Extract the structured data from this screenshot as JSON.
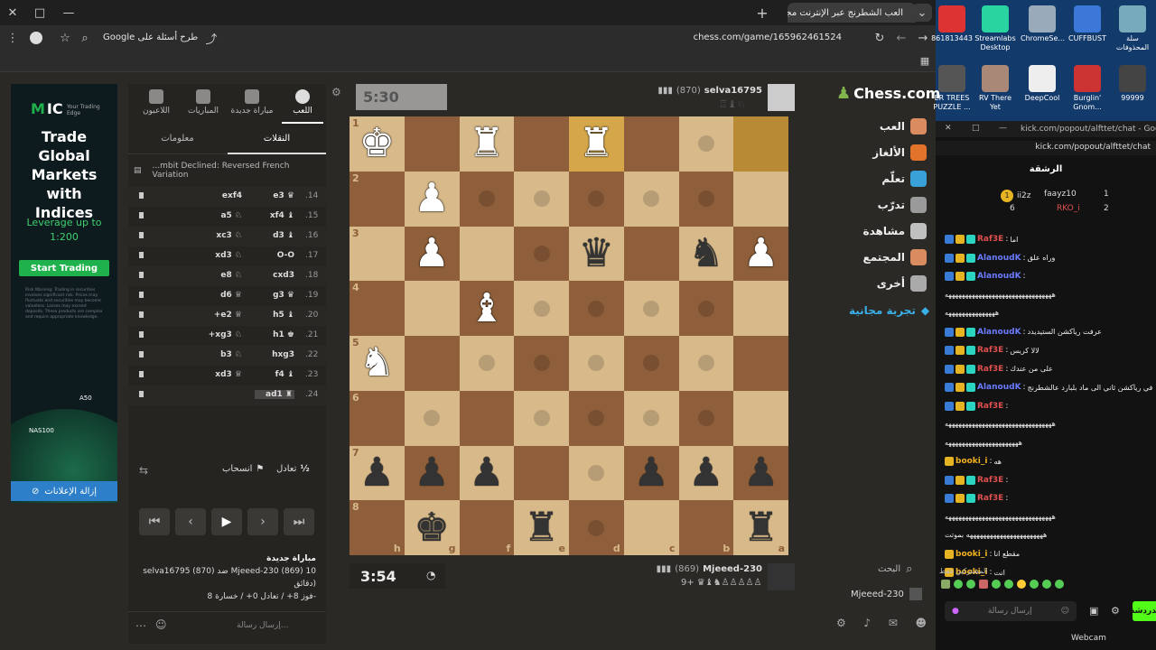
{
  "browser": {
    "tab_title": "العب الشطرنج عبر الإنترنت مجاناً",
    "url": "chess.com/game/165962461524",
    "google_query": "Google طرح أسئلة على"
  },
  "desktop": {
    "icons": [
      "861813443",
      "Streamlabs Desktop",
      "ChromeSe...",
      "CUFFBUST",
      "سلة المحذوفات",
      "ER TREES PUZZLE ...",
      "RV There Yet",
      "DeepCool",
      "Burglin' Gnom...",
      "99999"
    ]
  },
  "ad": {
    "brand": "IC",
    "tagline": "Your Trading Edge",
    "headline": "Trade Global Markets with Indices",
    "leverage": "Leverage up to 1:200",
    "cta": "Start Trading",
    "disclaimer": "Risk Warning: Trading in securities involves significant risk. Prices may fluctuate and securities may become valueless. Losses may exceed deposits. These products are complex and require appropriate knowledge.",
    "tag1": "A50",
    "tag2": "NAS100",
    "remove_ads": "إزالة الإعلانات"
  },
  "panel": {
    "tabs": [
      "اللعب",
      "مباراة جديدة",
      "المباريات",
      "اللاعبون"
    ],
    "subtabs": [
      "النقلات",
      "معلومات"
    ],
    "opening": "...mbit Declined: Reversed French Variation",
    "moves": [
      {
        "n": ".14",
        "w": "e3 ♛",
        "b": "exf4"
      },
      {
        "n": ".15",
        "w": "xf4 ♝",
        "b": "a5 ♘"
      },
      {
        "n": ".16",
        "w": "d3 ♝",
        "b": "xc3 ♘"
      },
      {
        "n": ".17",
        "w": "O-O",
        "b": "xd3 ♘"
      },
      {
        "n": ".18",
        "w": "cxd3",
        "b": "e8 ♘"
      },
      {
        "n": ".19",
        "w": "g3 ♛",
        "b": "d6 ♕"
      },
      {
        "n": ".20",
        "w": "h5 ♝",
        "b": "+e2 ♕"
      },
      {
        "n": ".21",
        "w": "h1 ♚",
        "b": "+xg3 ♘"
      },
      {
        "n": ".22",
        "w": "hxg3",
        "b": "b3 ♘"
      },
      {
        "n": ".23",
        "w": "f4 ♝",
        "b": "xd3 ♕"
      },
      {
        "n": ".24",
        "w": "ad1 ♜",
        "b": ""
      }
    ],
    "draw_label": "تعادل",
    "resign_label": "انسحاب",
    "half": "½",
    "new_game_title": "مباراة جديدة",
    "game_line1": "selva16795 (870) ضد Mjeeed-230 (869) 10",
    "game_line2": "دقائق)",
    "game_line3": "فوز 8+ / تعادل 0+ / خسارة 8-",
    "message_placeholder": "إرسال رسالة..."
  },
  "top_player": {
    "name": "selva16795",
    "rating": "(870)",
    "clock": "5:30"
  },
  "bottom_player": {
    "name": "Mjeeed-230",
    "rating": "(869)",
    "clock": "3:54",
    "material": "9+"
  },
  "board": {
    "files": [
      "h",
      "g",
      "f",
      "e",
      "d",
      "c",
      "b",
      "a"
    ],
    "rows": [
      [
        "wK",
        "",
        "wR",
        "",
        "wR",
        "",
        "",
        ""
      ],
      [
        "",
        "wP",
        "",
        "",
        "",
        "",
        "",
        ""
      ],
      [
        "",
        "wP",
        "",
        "",
        "bQ",
        "",
        "bN",
        "wP"
      ],
      [
        "",
        "",
        "wB",
        "",
        "",
        "",
        "",
        ""
      ],
      [
        "wN",
        "",
        "",
        "",
        "",
        "",
        "",
        ""
      ],
      [
        "",
        "",
        "",
        "",
        "",
        "",
        "",
        ""
      ],
      [
        "bP",
        "bP",
        "bP",
        "",
        "",
        "bP",
        "bP",
        "bP"
      ],
      [
        "",
        "bK",
        "",
        "bR",
        "",
        "",
        "",
        "bR"
      ]
    ],
    "highlights": [
      "0-4",
      "0-7"
    ]
  },
  "nav": {
    "logo": "Chess.com",
    "items": [
      "العب",
      "الألغاز",
      "تعلّم",
      "تدرّب",
      "مشاهدة",
      "المجتمع",
      "أخرى"
    ],
    "free_trial": "تجربة مجانية",
    "search": "البحث",
    "user": "Mjeeed-230"
  },
  "kick": {
    "url": "kick.com/popout/alfttet/chat",
    "url_short": "kick.com/popout/alfttet/chat - Google Ch...",
    "leaderboard": "الرشقة",
    "top": [
      {
        "rank": "1",
        "name": "ii2z",
        "count": "6"
      },
      {
        "name": "faayz10",
        "count": "1"
      },
      {
        "name": "RKO_i",
        "count": "2"
      }
    ],
    "messages": [
      {
        "u": "Raf3E",
        "t": "اما",
        "c": "#e05050"
      },
      {
        "u": "AlanoudK",
        "t": "وراه علق",
        "c": "#6a7bff"
      },
      {
        "u": "AlanoudK",
        "t": "",
        "c": "#6a7bff"
      },
      {
        "u": "",
        "t": "ههههههههههههههههههههههههههههههههه",
        "c": "#eee"
      },
      {
        "u": "",
        "t": "هههههههههههههههه",
        "c": "#eee"
      },
      {
        "u": "AlanoudK",
        "t": "عرفت ريأكشن الستيديدد",
        "c": "#6a7bff"
      },
      {
        "u": "Raf3E",
        "t": "لالا كريس",
        "c": "#e05050"
      },
      {
        "u": "Raf3E",
        "t": "على من عندك",
        "c": "#e05050"
      },
      {
        "u": "AlanoudK",
        "t": "في ريأكشن ثاني الى ماد بلبارد عالشطرنج",
        "c": "#6a7bff"
      },
      {
        "u": "Raf3E",
        "t": "",
        "c": "#e05050"
      },
      {
        "u": "",
        "t": "ههههههههههههههههههههههههههههههههه",
        "c": "#eee"
      },
      {
        "u": "",
        "t": "ههههههههههههههههههههههه",
        "c": "#eee"
      },
      {
        "u": "booki_i",
        "t": "هه",
        "c": "#f0b020"
      },
      {
        "u": "Raf3E",
        "t": "",
        "c": "#e05050"
      },
      {
        "u": "Raf3E",
        "t": "",
        "c": "#e05050"
      },
      {
        "u": "",
        "t": "ههههههههههههههههههههههههههههههههه",
        "c": "#eee"
      },
      {
        "u": "",
        "t": "هههههههههههههههههههههههه بموتت",
        "c": "#eee"
      },
      {
        "u": "booki_i",
        "t": "مقطع انا",
        "c": "#f0b020"
      },
      {
        "u": "booki_i",
        "t": "انت",
        "c": "#f0b020"
      }
    ],
    "subs_only": "المشتركين فقط",
    "send_placeholder": "إرسال رسالة",
    "send_button": "الدردشة",
    "webcam": "Webcam"
  }
}
